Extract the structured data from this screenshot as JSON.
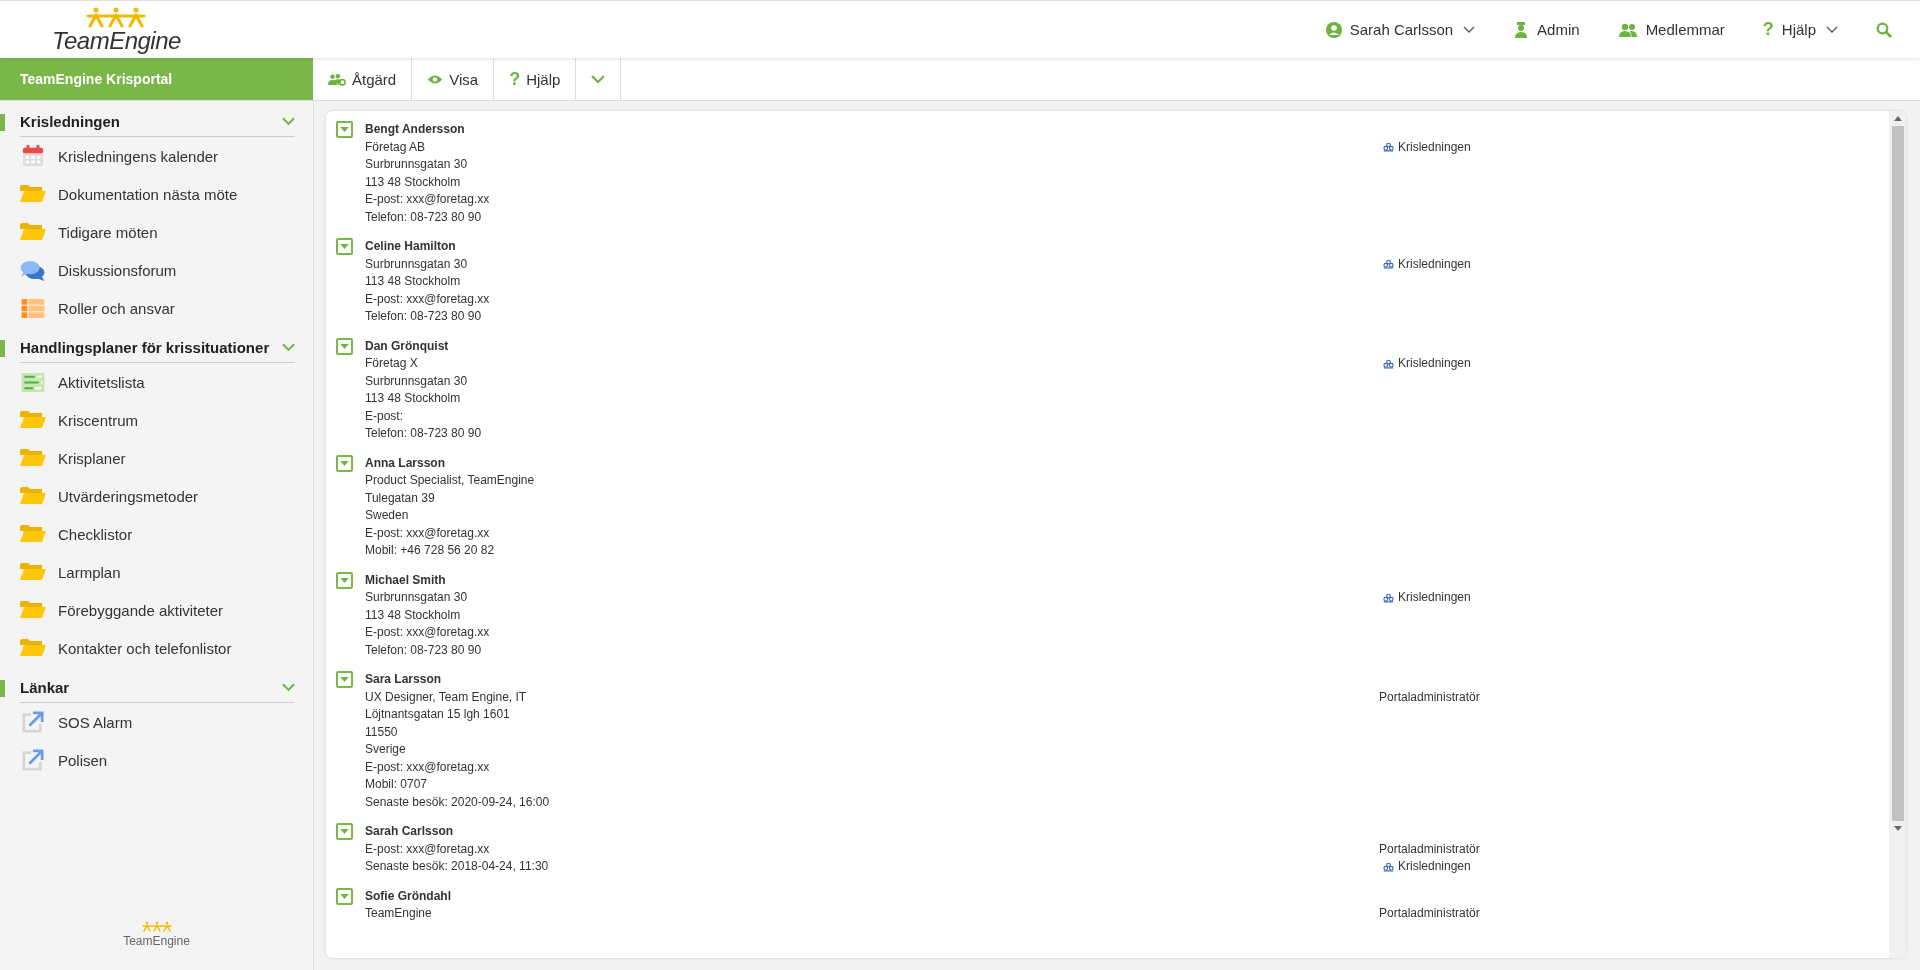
{
  "header": {
    "logo": "TeamEngine",
    "user": "Sarah Carlsson",
    "nav": [
      {
        "kind": "admin",
        "label": "Admin",
        "caret": false
      },
      {
        "kind": "members",
        "label": "Medlemmar",
        "caret": false
      },
      {
        "kind": "help",
        "label": "Hjälp",
        "icon_char": "?",
        "caret": true
      }
    ]
  },
  "portal_title": "TeamEngine Krisportal",
  "toolbar": [
    {
      "kind": "action",
      "label": "Åtgärd"
    },
    {
      "kind": "view",
      "label": "Visa"
    },
    {
      "kind": "help",
      "label": "Hjälp",
      "icon_char": "?"
    },
    {
      "kind": "more"
    }
  ],
  "sidebar": {
    "sections": [
      {
        "title": "Krisledningen",
        "expanded": true,
        "items": [
          {
            "kind": "calendar",
            "label": "Krisledningens kalender"
          },
          {
            "kind": "folder",
            "label": "Dokumentation nästa möte"
          },
          {
            "kind": "folder",
            "label": "Tidigare möten"
          },
          {
            "kind": "forum",
            "label": "Diskussionsforum"
          },
          {
            "kind": "table",
            "label": "Roller och ansvar"
          }
        ]
      },
      {
        "title": "Handlingsplaner för krissituationer",
        "expanded": true,
        "items": [
          {
            "kind": "list",
            "label": "Aktivitetslista"
          },
          {
            "kind": "folder",
            "label": "Kriscentrum"
          },
          {
            "kind": "folder",
            "label": "Krisplaner"
          },
          {
            "kind": "folder",
            "label": "Utvärderingsmetoder"
          },
          {
            "kind": "folder",
            "label": "Checklistor"
          },
          {
            "kind": "folder",
            "label": "Larmplan"
          },
          {
            "kind": "folder",
            "label": "Förebyggande aktiviteter"
          },
          {
            "kind": "folder",
            "label": "Kontakter och telefonlistor"
          }
        ]
      },
      {
        "title": "Länkar",
        "expanded": true,
        "items": [
          {
            "kind": "link",
            "label": "SOS Alarm"
          },
          {
            "kind": "link",
            "label": "Polisen"
          }
        ]
      }
    ],
    "footer_logo": "TeamEngine"
  },
  "contacts": [
    {
      "name": "Bengt Andersson",
      "lines": [
        "Företag AB",
        "Surbrunnsgatan 30",
        "113 48 Stockholm",
        "E-post: xxx@foretag.xx",
        "Telefon: 08-723 80 90"
      ],
      "roles": [
        {
          "kind": "group",
          "text": "Krisledningen"
        }
      ]
    },
    {
      "name": "Celine Hamilton",
      "lines": [
        "Surbrunnsgatan 30",
        "113 48 Stockholm",
        "E-post: xxx@foretag.xx",
        "Telefon: 08-723 80 90"
      ],
      "roles": [
        {
          "kind": "group",
          "text": "Krisledningen"
        }
      ]
    },
    {
      "name": "Dan Grönquist",
      "lines": [
        "Företag X",
        "Surbrunnsgatan 30",
        "113 48 Stockholm",
        "E-post:",
        "Telefon: 08-723 80 90"
      ],
      "roles": [
        {
          "kind": "group",
          "text": "Krisledningen"
        }
      ]
    },
    {
      "name": "Anna Larsson",
      "lines": [
        "Product Specialist, TeamEngine",
        "Tulegatan 39",
        "Sweden",
        "E-post: xxx@foretag.xx",
        "Mobil: +46 728 56 20 82"
      ]
    },
    {
      "name": "Michael Smith",
      "lines": [
        "Surbrunnsgatan 30",
        "113 48 Stockholm",
        "E-post: xxx@foretag.xx",
        "Telefon: 08-723 80 90"
      ],
      "roles": [
        {
          "kind": "group",
          "text": "Krisledningen"
        }
      ]
    },
    {
      "name": "Sara Larsson",
      "lines": [
        "UX Designer, Team Engine, IT",
        "Löjtnantsgatan 15 lgh 1601",
        "11550",
        "Sverige",
        "E-post: xxx@foretag.xx",
        "Mobil: 0707",
        "Senaste besök: 2020-09-24, 16:00"
      ],
      "roles": [
        {
          "kind": "role",
          "text": "Portaladministratör"
        }
      ]
    },
    {
      "name": "Sarah Carlsson",
      "lines": [
        "E-post: xxx@foretag.xx",
        "Senaste besök: 2018-04-24, 11:30"
      ],
      "roles": [
        {
          "kind": "role",
          "text": "Portaladministratör"
        },
        {
          "kind": "group",
          "text": "Krisledningen"
        }
      ]
    },
    {
      "name": "Sofie Gröndahl",
      "lines": [
        "TeamEngine"
      ],
      "roles": [
        {
          "kind": "role",
          "text": "Portaladministratör"
        }
      ]
    }
  ]
}
